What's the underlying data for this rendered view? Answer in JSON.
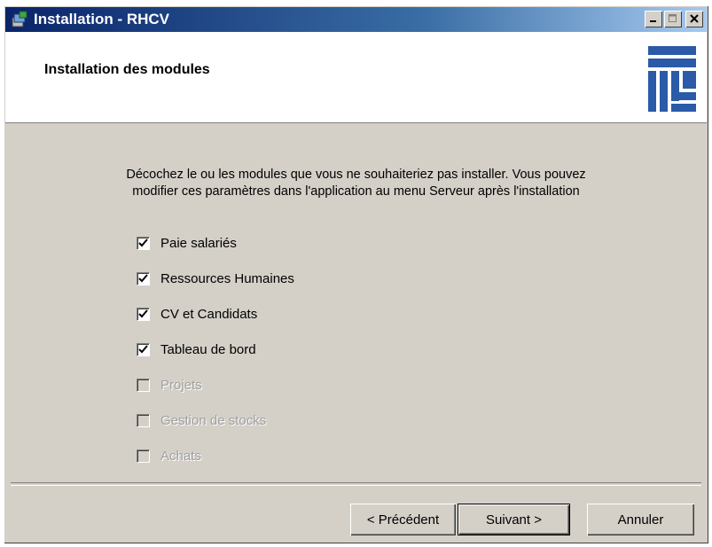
{
  "window": {
    "title": "Installation - RHCV",
    "controls": [
      "minimize",
      "maximize",
      "close"
    ]
  },
  "header": {
    "title": "Installation des modules",
    "logo_color": "#2b5aa8"
  },
  "instructions": {
    "line1": "Décochez le ou les modules que vous ne souhaiteriez pas installer. Vous pouvez",
    "line2": "modifier ces paramètres dans l'application au menu Serveur après l'installation"
  },
  "modules": [
    {
      "label": "Paie salariés",
      "checked": true,
      "enabled": true
    },
    {
      "label": "Ressources Humaines",
      "checked": true,
      "enabled": true
    },
    {
      "label": "CV et Candidats",
      "checked": true,
      "enabled": true
    },
    {
      "label": "Tableau de bord",
      "checked": true,
      "enabled": true
    },
    {
      "label": "Projets",
      "checked": false,
      "enabled": false
    },
    {
      "label": "Gestion de stocks",
      "checked": false,
      "enabled": false
    },
    {
      "label": "Achats",
      "checked": false,
      "enabled": false
    }
  ],
  "buttons": {
    "previous": "< Précédent",
    "next": "Suivant >",
    "cancel": "Annuler"
  },
  "icons": {
    "app": "installer-icon",
    "logo": "rhcv-logo"
  }
}
